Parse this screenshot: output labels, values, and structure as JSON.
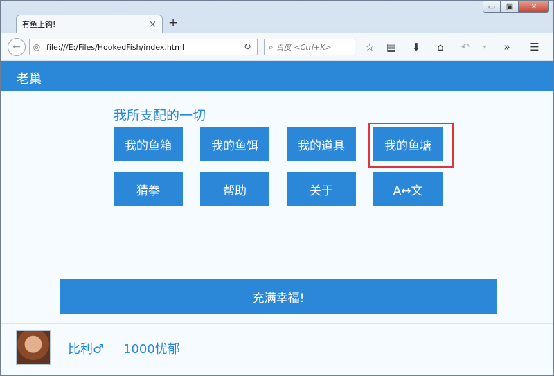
{
  "window": {
    "controls": {
      "minimize": "▭",
      "maximize": "▣",
      "close": "✕"
    }
  },
  "browser": {
    "tab": {
      "title": "有鱼上钩!",
      "close": "×"
    },
    "new_tab": "+",
    "url": "file:///E:/Files/HookedFish/index.html",
    "search_placeholder": "百度 <Ctrl+K>"
  },
  "page": {
    "site_title": "老巢",
    "section_title": "我所支配的一切",
    "buttons_row1": [
      "我的鱼箱",
      "我的鱼饵",
      "我的道具",
      "我的鱼塘"
    ],
    "buttons_row2": [
      "猜拳",
      "帮助",
      "关于",
      "A↔文"
    ],
    "happy_button": "充满幸福!",
    "footer": {
      "user_name": "比利♂",
      "currency": "1000忧郁"
    }
  },
  "colors": {
    "accent": "#2b87d8",
    "highlight": "#d9363e",
    "page_bg": "#f5fbfe"
  }
}
